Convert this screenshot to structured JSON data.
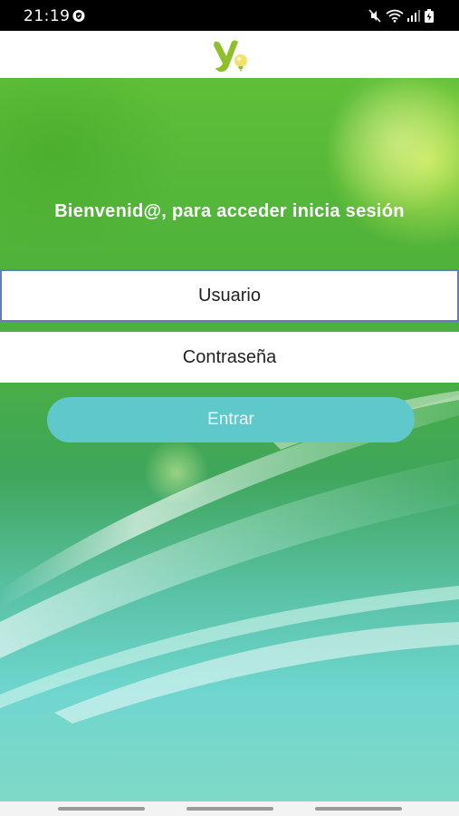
{
  "status_bar": {
    "time": "21:19",
    "icons": [
      "shield-check-icon",
      "mute-icon",
      "wifi-icon",
      "signal-icon",
      "battery-icon"
    ]
  },
  "header": {
    "logo": "app-logo-icon"
  },
  "login": {
    "welcome": "Bienvenid@, para acceder inicia sesión",
    "username_placeholder": "Usuario",
    "password_placeholder": "Contraseña",
    "submit_label": "Entrar"
  },
  "nav_bar": {
    "items": [
      "recent-apps-button",
      "home-button",
      "back-button"
    ]
  },
  "colors": {
    "status_bar_bg": "#000000",
    "header_bg": "#ffffff",
    "button_bg": "#5ec8cb",
    "field_focus_border": "#5b7fbf"
  }
}
